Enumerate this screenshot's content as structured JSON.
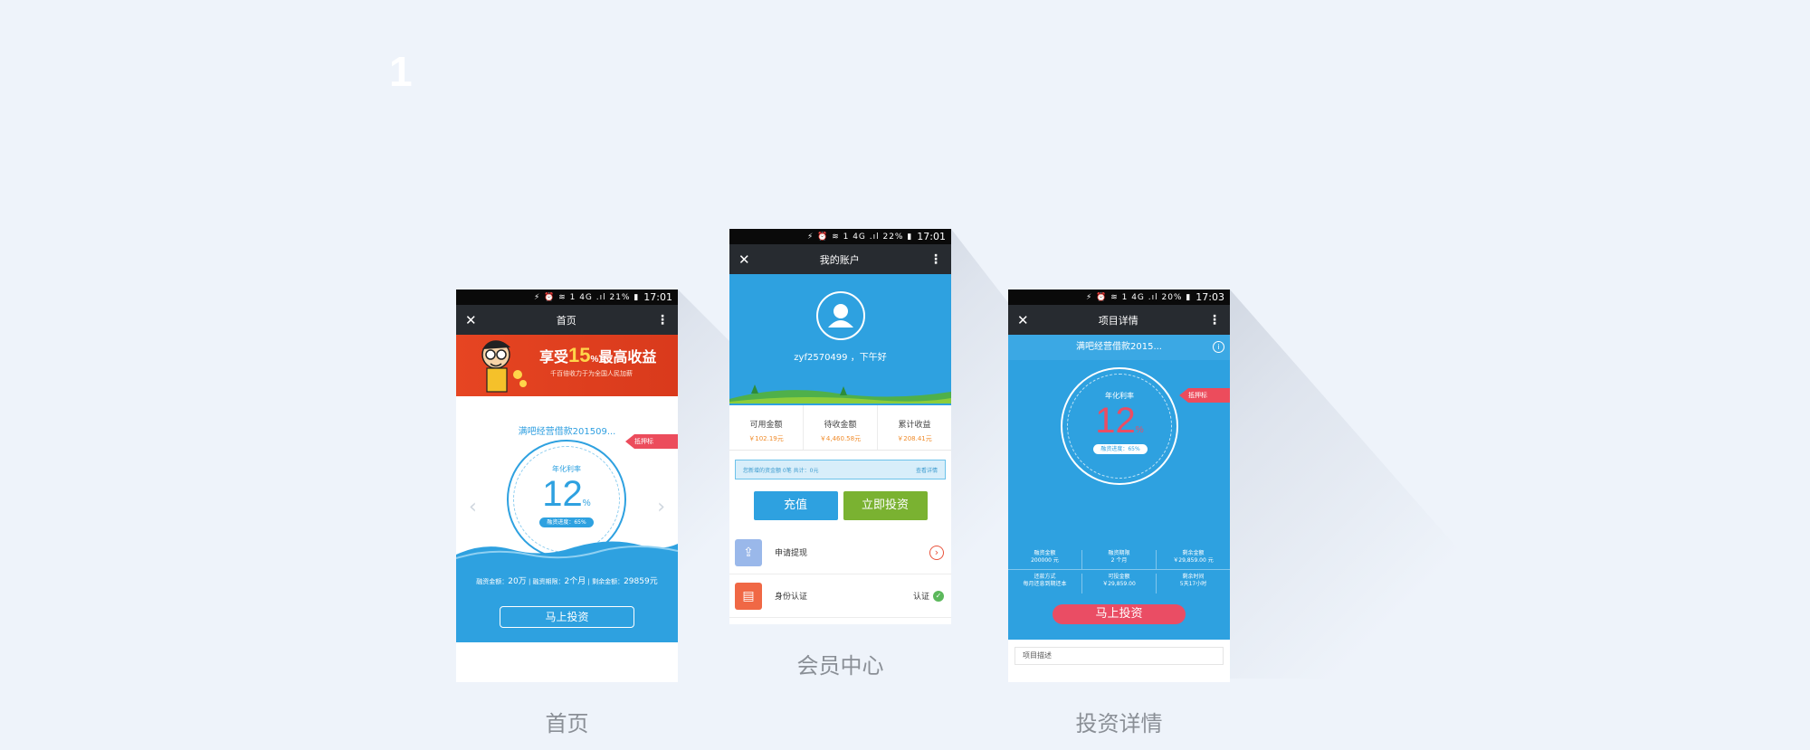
{
  "page_number": "1",
  "home": {
    "status_time": "17:01",
    "status_icons": "⚡ ⏰ ≋ 1 4G .ıl 21% ▮",
    "title": "首页",
    "banner_title_pre": "享受",
    "banner_title_highlight": "15",
    "banner_title_pct": "%",
    "banner_title_post": "最高收益",
    "banner_sub": "千百倍收力于为全国人民加薪",
    "loan_name": "满吧经营借款201509...",
    "tag": "抵押标",
    "rate_label": "年化利率",
    "rate_value": "12",
    "rate_unit": "%",
    "progress_label": "融资进度：65%",
    "progress": 0.65,
    "info_amount_label": "融资金额：",
    "info_amount": "20万",
    "info_period_label": "融资期限：",
    "info_period": "2个月",
    "info_remain_label": "剩余金额：",
    "info_remain": "29859元",
    "invest_button": "马上投资",
    "caption": "首页"
  },
  "account": {
    "status_time": "17:01",
    "status_icons": "⚡ ⏰ ≋ 1 4G .ıl 22% ▮",
    "title": "我的账户",
    "username": "zyf2570499 ，下午好",
    "stats": [
      {
        "label": "可用金额",
        "value": "￥102.19元"
      },
      {
        "label": "待收金额",
        "value": "￥4,460.58元"
      },
      {
        "label": "累计收益",
        "value": "￥208.41元"
      }
    ],
    "notice_left": "您新增的资金额 0笔  共计：0元",
    "notice_right": "查看详情",
    "recharge_button": "充值",
    "invest_button": "立即投资",
    "rows": [
      {
        "label": "申请提现",
        "right": ""
      },
      {
        "label": "身份认证",
        "right": "认证"
      }
    ],
    "caption": "会员中心"
  },
  "detail": {
    "status_time": "17:03",
    "status_icons": "⚡ ⏰ ≋ 1 4G .ıl 20% ▮",
    "title": "项目详情",
    "loan_name": "满吧经营借款2015...",
    "tag": "抵押标",
    "rate_label": "年化利率",
    "rate_value": "12",
    "rate_unit": "%",
    "progress_label": "融资进度：65%",
    "progress": 0.65,
    "grid_row1": [
      {
        "label": "融资金额",
        "value": "200000 元"
      },
      {
        "label": "融资期限",
        "value": "2 个月"
      },
      {
        "label": "剩余金额",
        "value": "￥29,859.00 元"
      }
    ],
    "grid_row2": [
      {
        "label": "还款方式",
        "value": "每月还息到期还本"
      },
      {
        "label": "可投金额",
        "value": "￥29,859.00"
      },
      {
        "label": "剩余时间",
        "value": "5天17小时"
      }
    ],
    "invest_button": "马上投资",
    "desc_row": "项目描述",
    "caption": "投资详情"
  },
  "colors": {
    "background": "#eef3fa",
    "brand_blue": "#2ea1e0",
    "green": "#7ab231",
    "red": "#ea4d64",
    "orange": "#f08c2c"
  }
}
